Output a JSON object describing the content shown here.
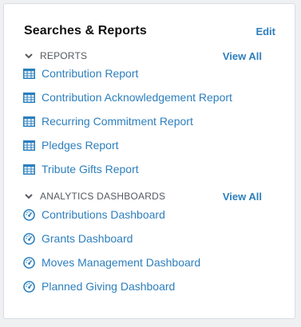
{
  "card": {
    "title": "Searches & Reports",
    "edit_label": "Edit"
  },
  "reports": {
    "header": "REPORTS",
    "view_all": "View All",
    "items": [
      {
        "label": "Contribution Report",
        "icon": "table-icon"
      },
      {
        "label": "Contribution Acknowledgement Report",
        "icon": "table-icon"
      },
      {
        "label": "Recurring Commitment Report",
        "icon": "table-icon"
      },
      {
        "label": "Pledges Report",
        "icon": "table-icon"
      },
      {
        "label": "Tribute Gifts Report",
        "icon": "table-icon"
      }
    ]
  },
  "dashboards": {
    "header": "ANALYTICS DASHBOARDS",
    "view_all": "View All",
    "items": [
      {
        "label": "Contributions Dashboard",
        "icon": "gauge-icon"
      },
      {
        "label": "Grants Dashboard",
        "icon": "gauge-icon"
      },
      {
        "label": "Moves Management Dashboard",
        "icon": "gauge-icon"
      },
      {
        "label": "Planned Giving Dashboard",
        "icon": "gauge-icon"
      }
    ]
  },
  "colors": {
    "link": "#2d7fbd",
    "section_text": "#555a60",
    "title": "#111111"
  }
}
